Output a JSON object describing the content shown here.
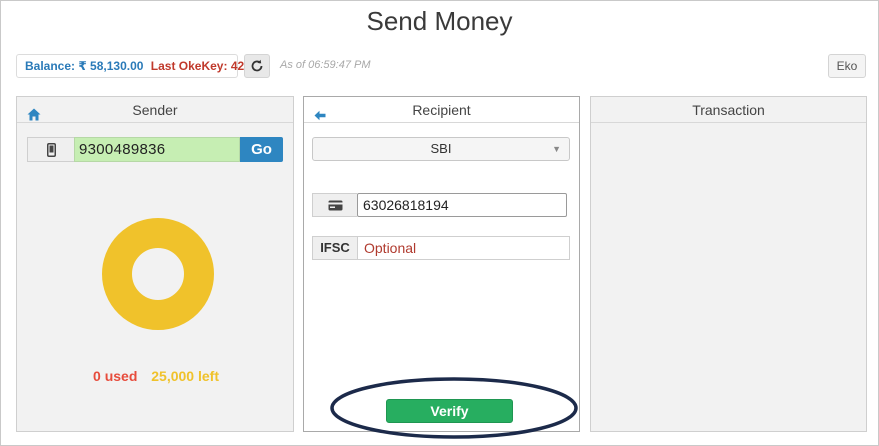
{
  "page": {
    "title": "Send Money"
  },
  "header": {
    "balance_label": "Balance: ₹ 58,130.00",
    "last_okekey": "Last OkeKey: 42",
    "refresh_icon": "refresh-icon",
    "as_of": "As of 06:59:47 PM",
    "eko_label": "Eko"
  },
  "sender": {
    "title": "Sender",
    "home_icon": "home-icon",
    "mobile_icon": "mobile-icon",
    "mobile_number": "9300489836",
    "go_label": "Go",
    "used_label": "0 used",
    "left_label": "25,000 left",
    "limit_used_fraction": 0
  },
  "recipient": {
    "title": "Recipient",
    "back_icon": "back-arrow-icon",
    "bank_selected": "SBI",
    "card_icon": "card-icon",
    "account_number": "63026818194",
    "ifsc_label": "IFSC",
    "ifsc_placeholder": "Optional",
    "verify_label": "Verify"
  },
  "transaction": {
    "title": "Transaction"
  },
  "colors": {
    "accent_blue": "#2e86c1",
    "verify_green": "#27ae60",
    "used_red": "#e74c3c",
    "left_yellow": "#f0c22b",
    "mobile_field_green": "#c6eeb3",
    "highlight_oval": "#1c2a4a"
  }
}
